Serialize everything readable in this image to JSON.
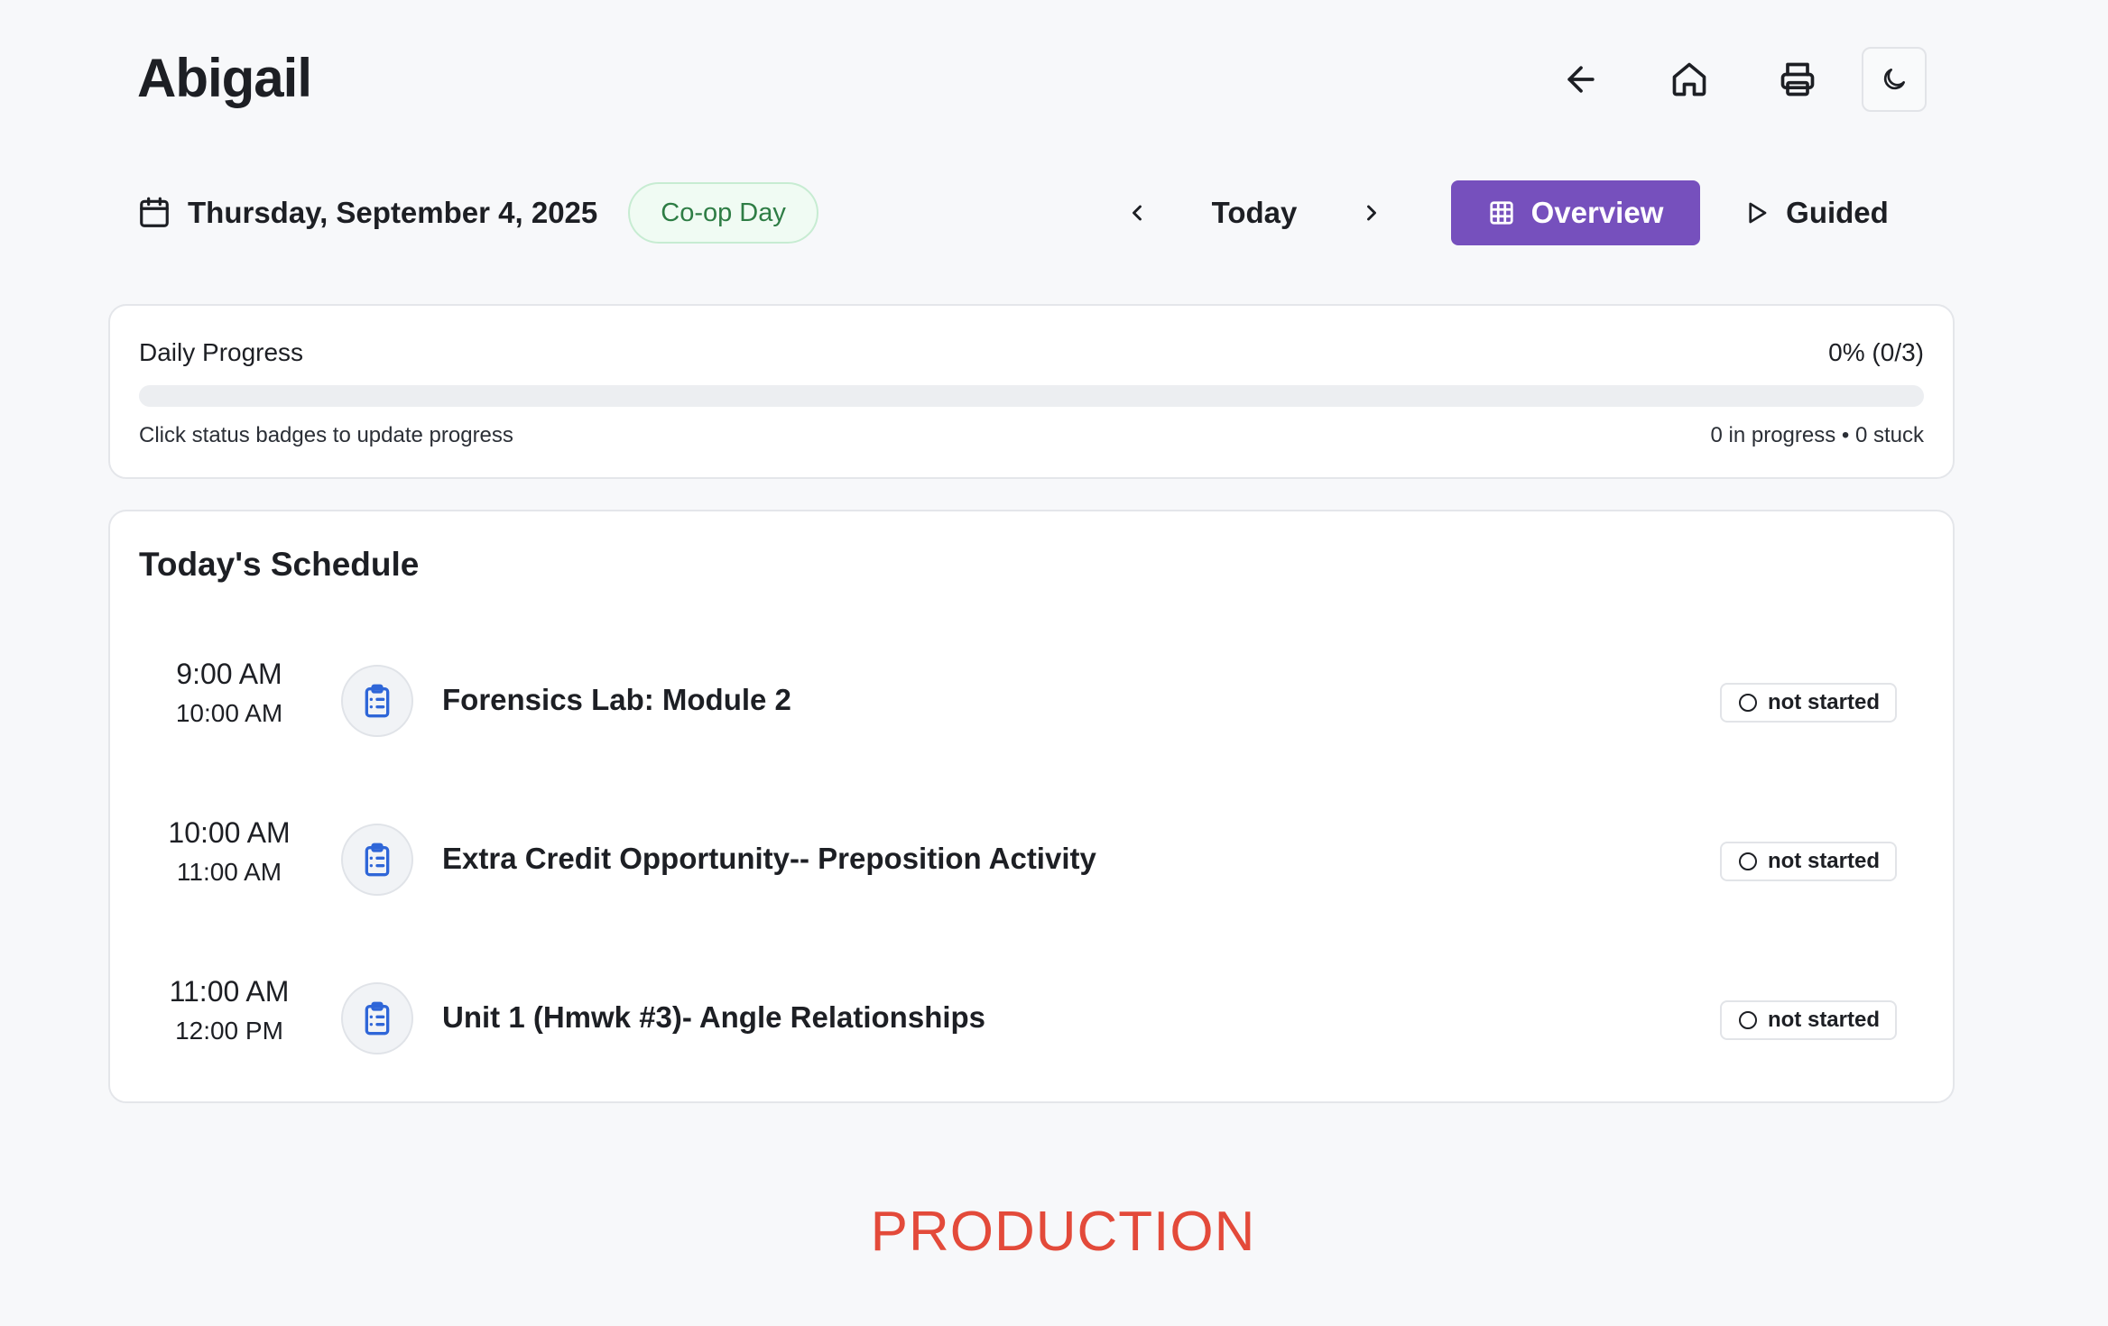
{
  "header": {
    "title": "Abigail",
    "icons": [
      "arrow-left-icon",
      "home-icon",
      "printer-icon",
      "moon-icon"
    ]
  },
  "date_bar": {
    "date": "Thursday, September 4, 2025",
    "day_badge": "Co-op Day",
    "today_label": "Today",
    "overview_label": "Overview",
    "guided_label": "Guided"
  },
  "progress": {
    "label": "Daily Progress",
    "value_text": "0% (0/3)",
    "percent": 0,
    "hint": "Click status badges to update progress",
    "stats": "0 in progress • 0 stuck"
  },
  "schedule": {
    "title": "Today's Schedule",
    "items": [
      {
        "start": "9:00 AM",
        "end": "10:00 AM",
        "title": "Forensics Lab: Module 2",
        "status": "not started"
      },
      {
        "start": "10:00 AM",
        "end": "11:00 AM",
        "title": "Extra Credit Opportunity-- Preposition Activity",
        "status": "not started"
      },
      {
        "start": "11:00 AM",
        "end": "12:00 PM",
        "title": "Unit 1 (Hmwk #3)- Angle Relationships",
        "status": "not started"
      }
    ]
  },
  "environment_label": "PRODUCTION",
  "colors": {
    "accent": "#7650bd",
    "badge_green": "#2e7d45",
    "task_icon_blue": "#2f66d8",
    "env_label_red": "#e34a3a"
  }
}
